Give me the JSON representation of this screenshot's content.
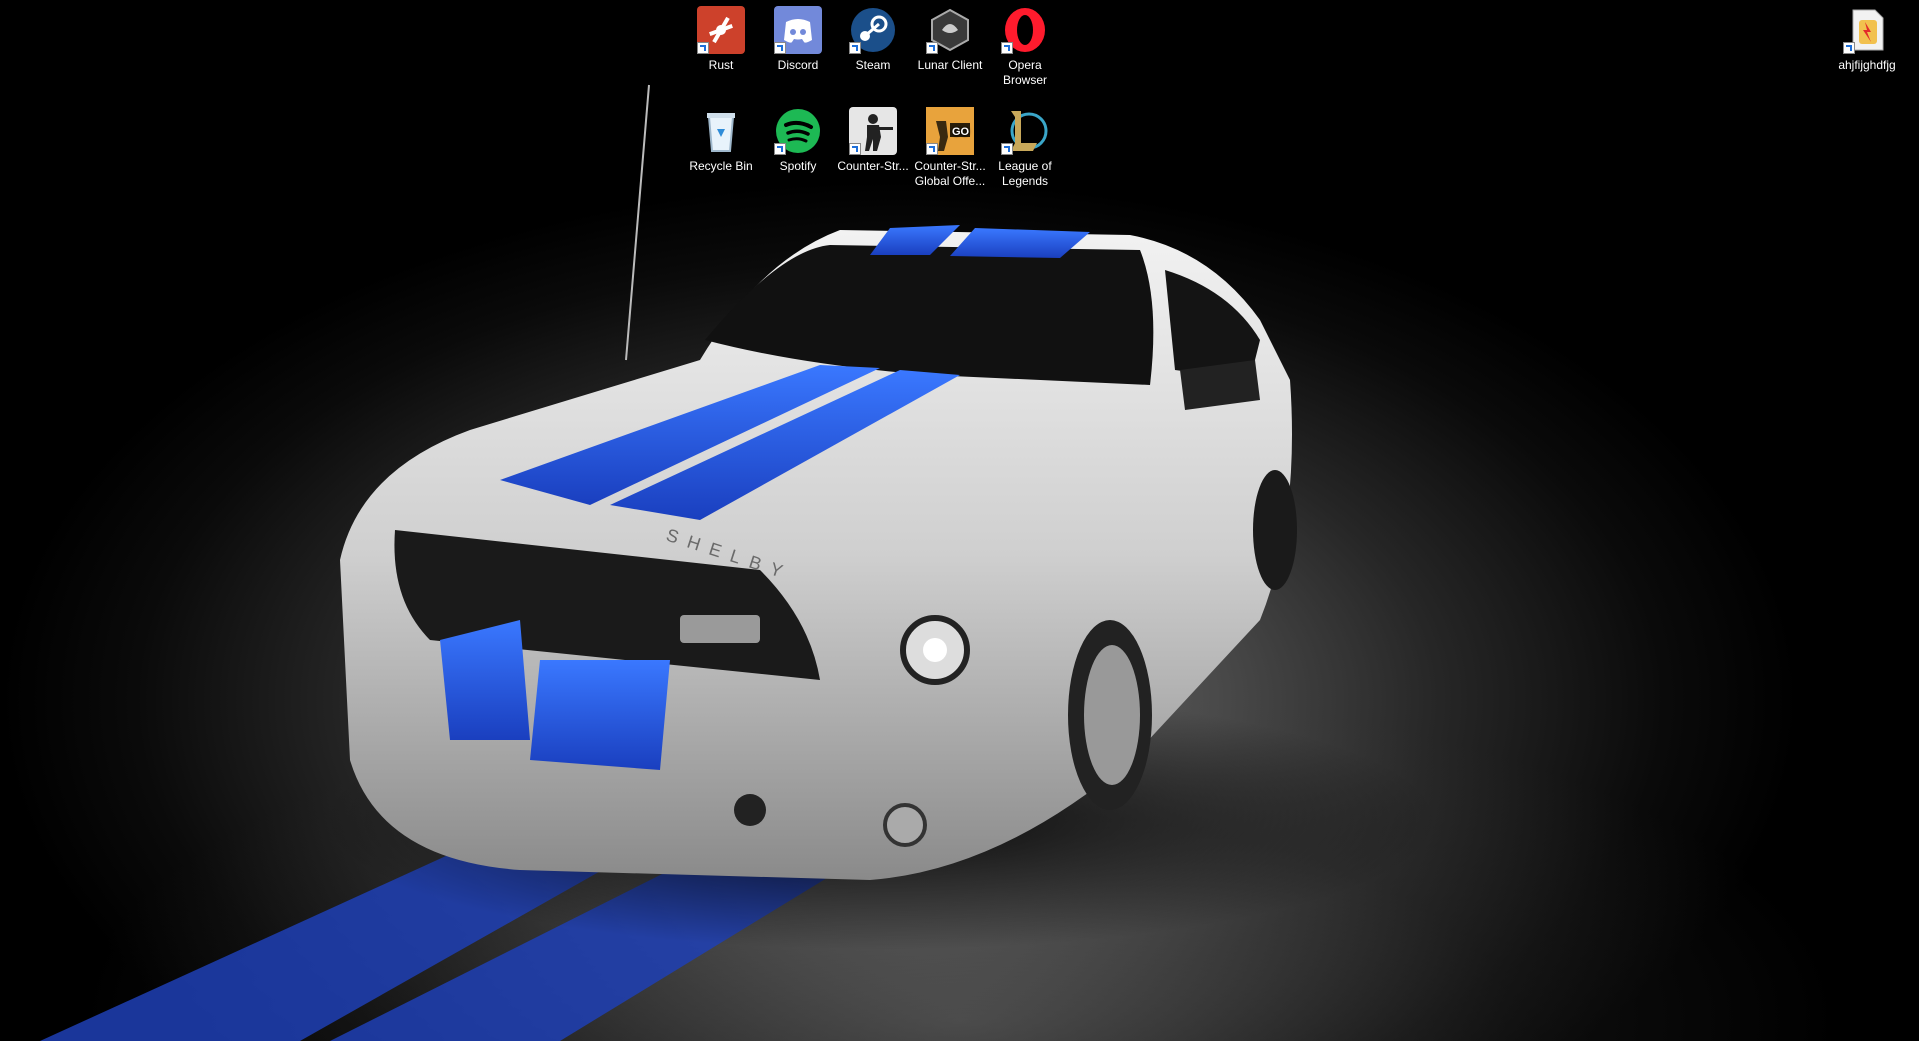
{
  "desktop": {
    "icons": [
      {
        "id": "rust",
        "label": "Rust",
        "icon": "rust-icon",
        "color": "#cd412b"
      },
      {
        "id": "discord",
        "label": "Discord",
        "icon": "discord-icon",
        "color": "#7289da"
      },
      {
        "id": "steam",
        "label": "Steam",
        "icon": "steam-icon",
        "color": "#1b2838"
      },
      {
        "id": "lunar",
        "label": "Lunar Client",
        "icon": "lunar-client-icon",
        "color": "#8a8a8a"
      },
      {
        "id": "opera",
        "label": "Opera Browser",
        "icon": "opera-icon",
        "color": "#ff1b2d"
      },
      {
        "id": "recycle",
        "label": "Recycle Bin",
        "icon": "recycle-bin-icon",
        "color": "#cfe6f7"
      },
      {
        "id": "spotify",
        "label": "Spotify",
        "icon": "spotify-icon",
        "color": "#1db954"
      },
      {
        "id": "cs",
        "label": "Counter-Str...",
        "icon": "counter-strike-icon",
        "color": "#d8d8d8"
      },
      {
        "id": "csgo",
        "label": "Counter-Str... Global Offe...",
        "icon": "csgo-icon",
        "color": "#e8a33c"
      },
      {
        "id": "lol",
        "label": "League of Legends",
        "icon": "league-of-legends-icon",
        "color": "#c8a85a"
      },
      {
        "id": "file",
        "label": "ahjfijghdfjg",
        "icon": "file-icon",
        "color": "#f2c14e"
      }
    ]
  },
  "wallpaper": {
    "description_colors": {
      "car_body": "#d8d8d8",
      "stripe": "#1f52d6",
      "background": "#000000"
    },
    "badge_text": "SHELBY"
  }
}
